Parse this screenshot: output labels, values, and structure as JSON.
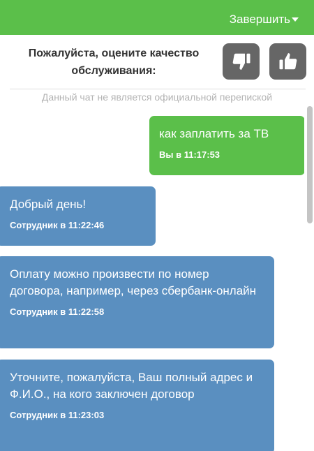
{
  "header": {
    "end_label": "Завершить",
    "accent_color": "#5bbf4a"
  },
  "rating": {
    "prompt": "Пожалуйста, оцените качество обслуживания:",
    "dislike_icon": "thumbs-down-icon",
    "like_icon": "thumbs-up-icon"
  },
  "notice": "Данный чат не является официальной перепиской",
  "messages": [
    {
      "sender": "user",
      "text": "как заплатить за ТВ",
      "meta": "Вы в 11:17:53",
      "color": "#5bbf4a"
    },
    {
      "sender": "agent",
      "text": "Добрый день!",
      "meta": "Сотрудник в 11:22:46",
      "color": "#5a8fc0"
    },
    {
      "sender": "agent",
      "text": "Оплату можно произвести по номер договора, например, через сбербанк-онлайн",
      "meta": "Сотрудник в 11:22:58",
      "color": "#5a8fc0"
    },
    {
      "sender": "agent",
      "text": "Уточните, пожалуйста, Ваш полный адрес и Ф.И.О., на кого заключен договор",
      "meta": "Сотрудник в 11:23:03",
      "color": "#5a8fc0"
    }
  ]
}
